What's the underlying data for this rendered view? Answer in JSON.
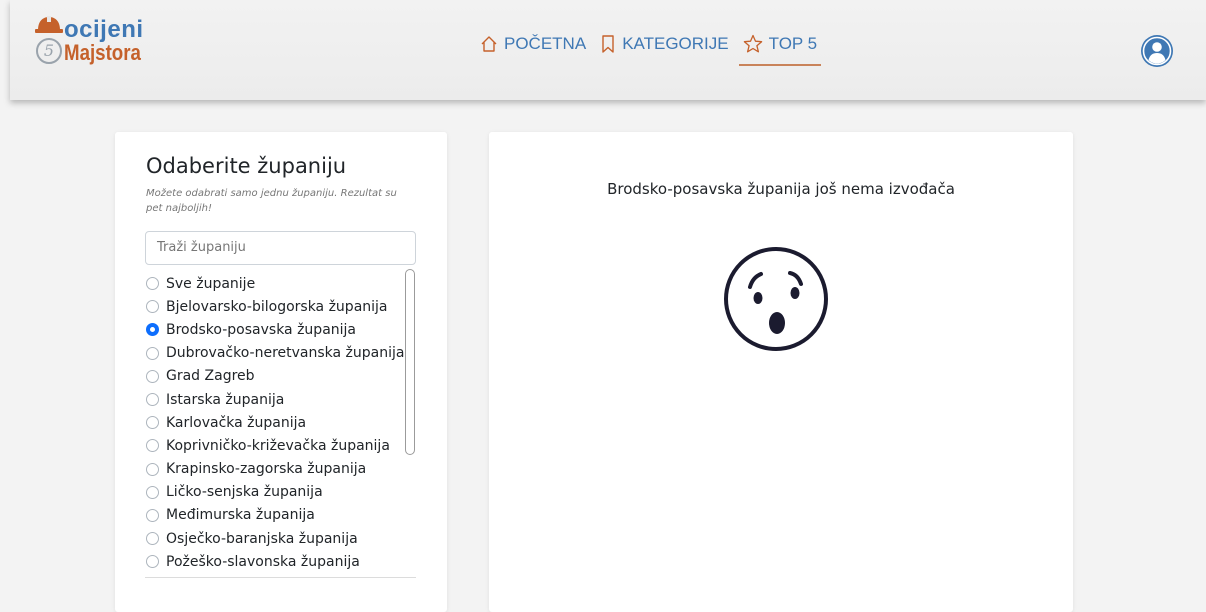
{
  "brand": {
    "word1": "ocijeni",
    "word2": "Majstora",
    "digit": "5",
    "colors": {
      "blue": "#3f78b4",
      "orange": "#c5612b"
    }
  },
  "nav": {
    "items": [
      {
        "label": "POČETNA",
        "icon": "home-icon",
        "active": false
      },
      {
        "label": "KATEGORIJE",
        "icon": "bookmark-icon",
        "active": false
      },
      {
        "label": "TOP 5",
        "icon": "star-icon",
        "active": true
      }
    ],
    "user_icon": "user-circle-icon"
  },
  "sidebar": {
    "title": "Odaberite županiju",
    "hint": "Možete odabrati samo jednu županiju. Rezultat su pet najboljih!",
    "search_placeholder": "Traži županiju",
    "selected": "Brodsko-posavska županija",
    "items": [
      "Sve županije",
      "Bjelovarsko-bilogorska županija",
      "Brodsko-posavska županija",
      "Dubrovačko-neretvanska županija",
      "Grad Zagreb",
      "Istarska županija",
      "Karlovačka županija",
      "Koprivničko-križevačka županija",
      "Krapinsko-zagorska županija",
      "Ličko-senjska županija",
      "Međimurska županija",
      "Osječko-baranjska županija",
      "Požeško-slavonska županija"
    ]
  },
  "main": {
    "message": "Brodsko-posavska županija još nema izvođača",
    "illustration": "surprised-face-icon"
  }
}
